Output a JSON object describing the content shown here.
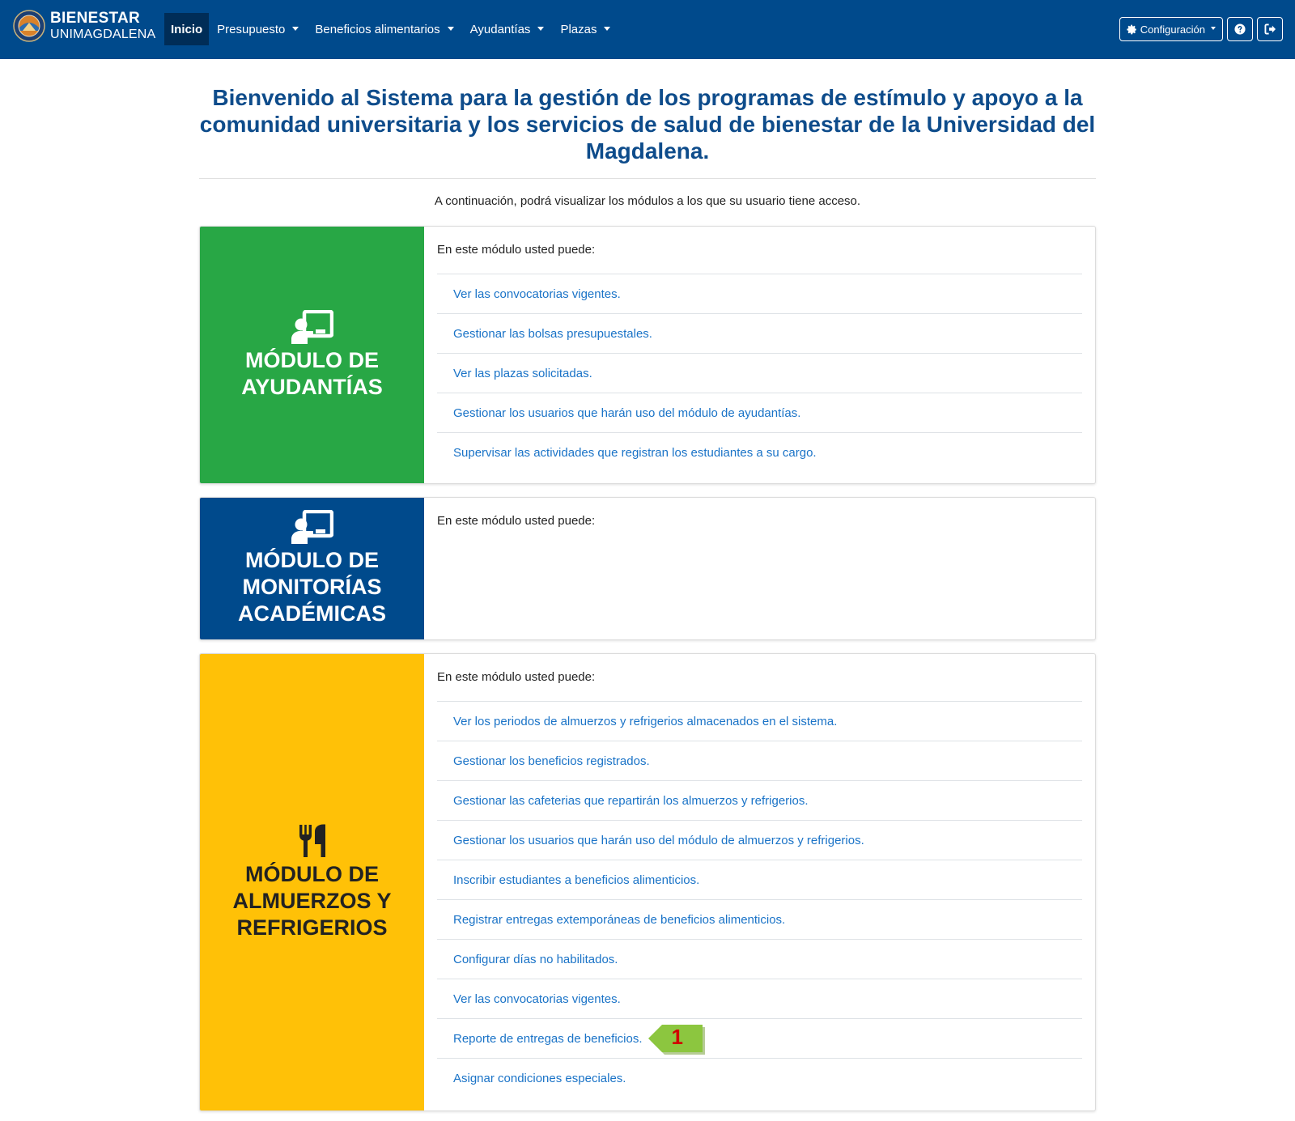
{
  "navbar": {
    "brand_line1": "BIENESTAR",
    "brand_line2": "UNIMAGDALENA",
    "items": [
      {
        "label": "Inicio"
      },
      {
        "label": "Presupuesto"
      },
      {
        "label": "Beneficios alimentarios"
      },
      {
        "label": "Ayudantías"
      },
      {
        "label": "Plazas"
      }
    ],
    "config_label": "Configuración",
    "help_icon": "question-circle-icon",
    "logout_icon": "sign-out-icon"
  },
  "header": {
    "title": "Bienvenido al Sistema para la gestión de los programas de estímulo y apoyo a la comunidad universitaria y los servicios de salud de bienestar de la Universidad del Magdalena.",
    "subtitle": "A continuación, podrá visualizar los módulos a los que su usuario tiene acceso."
  },
  "modules": [
    {
      "title": "MÓDULO DE AYUDANTÍAS",
      "icon": "chalkboard-teacher-icon",
      "color": "#28a745",
      "intro": "En este módulo usted puede:",
      "links": [
        "Ver las convocatorias vigentes.",
        "Gestionar las bolsas presupuestales.",
        "Ver las plazas solicitadas.",
        "Gestionar los usuarios que harán uso del módulo de ayudantías.",
        "Supervisar las actividades que registran los estudiantes a su cargo."
      ]
    },
    {
      "title": "MÓDULO DE MONITORÍAS ACADÉMICAS",
      "icon": "chalkboard-teacher-icon",
      "color": "#004a8c",
      "intro": "En este módulo usted puede:",
      "links": []
    },
    {
      "title": "MÓDULO DE ALMUERZOS Y REFRIGERIOS",
      "icon": "utensils-icon",
      "color": "#ffc107",
      "intro": "En este módulo usted puede:",
      "links": [
        "Ver los periodos de almuerzos y refrigerios almacenados en el sistema.",
        "Gestionar los beneficios registrados.",
        "Gestionar las cafeterias que repartirán los almuerzos y refrigerios.",
        "Gestionar los usuarios que harán uso del módulo de almuerzos y refrigerios.",
        "Inscribir estudiantes a beneficios alimenticios.",
        "Registrar entregas extemporáneas de beneficios alimenticios.",
        "Configurar días no habilitados.",
        "Ver las convocatorias vigentes.",
        "Reporte de entregas de beneficios.",
        "Asignar condiciones especiales."
      ]
    }
  ],
  "callout": {
    "number": "1",
    "color": "#8cc63f"
  }
}
